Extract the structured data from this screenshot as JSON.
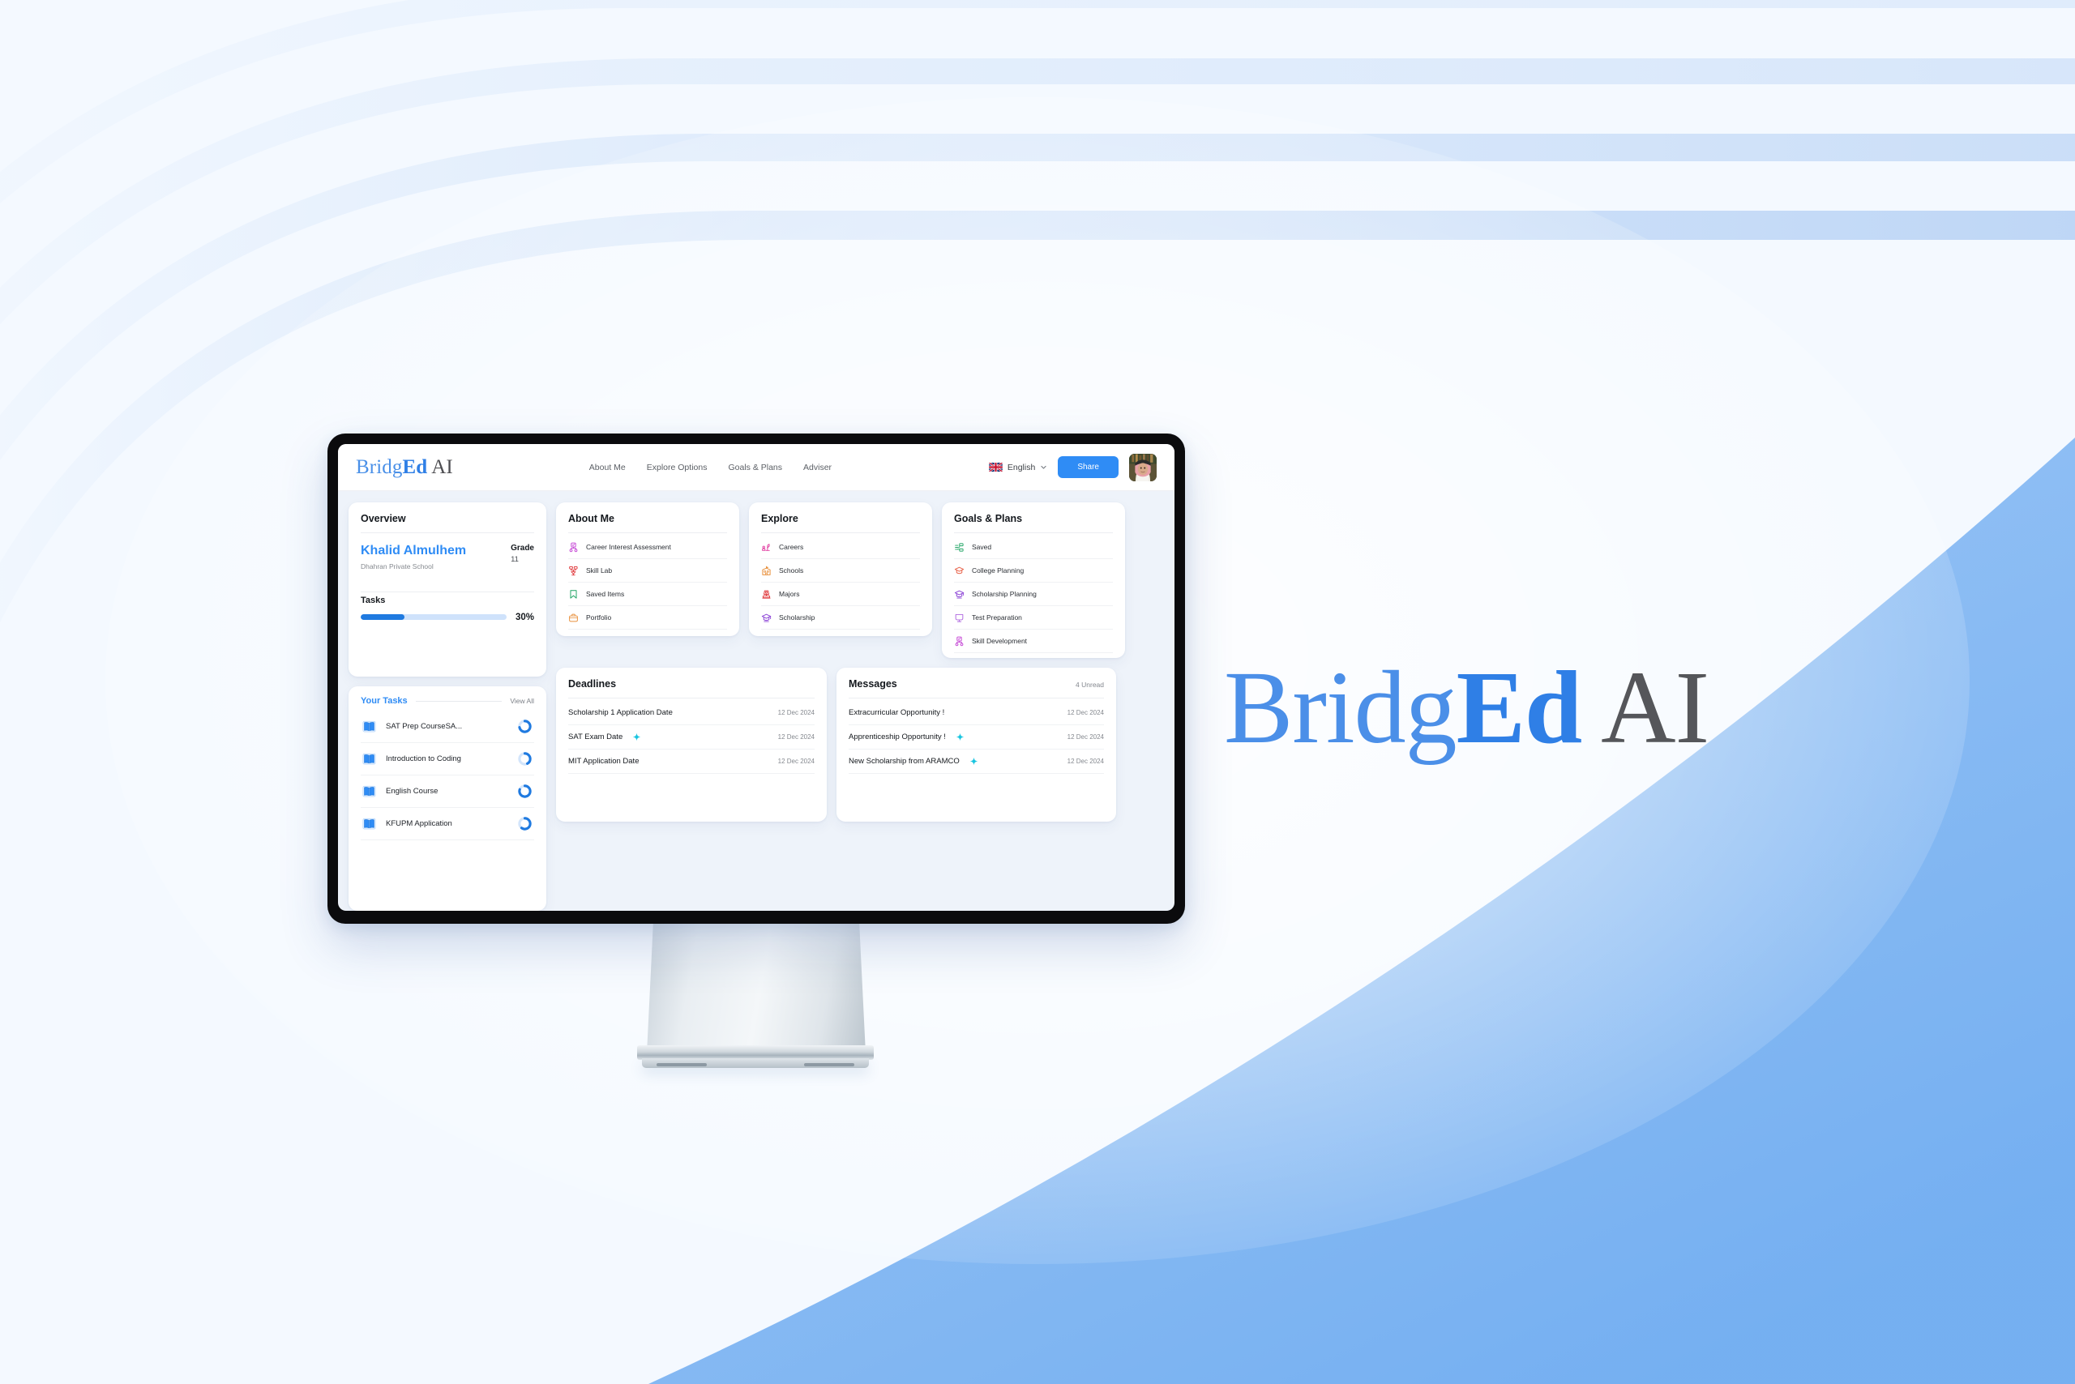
{
  "brand": {
    "part1": "Bridg",
    "part2": "Ed",
    "part3": " AI"
  },
  "header": {
    "nav": [
      {
        "label": "About Me"
      },
      {
        "label": "Explore Options"
      },
      {
        "label": "Goals & Plans"
      },
      {
        "label": "Adviser"
      }
    ],
    "language": "English",
    "share_label": "Share",
    "flag_icon": "uk-flag-icon",
    "chevron_icon": "chevron-down-icon",
    "avatar_icon": "user-avatar"
  },
  "overview": {
    "title": "Overview",
    "student_name": "Khalid Almulhem",
    "school": "Dhahran Private School",
    "grade_label": "Grade",
    "grade_value": "11",
    "tasks_label": "Tasks",
    "progress_percent": "30%",
    "progress_value": 30
  },
  "tasks": {
    "section_label": "Your Tasks",
    "view_all_label": "View All",
    "items": [
      {
        "label": "SAT Prep CourseSA...",
        "icon": "book-icon",
        "progress": 72
      },
      {
        "label": "Introduction to Coding",
        "icon": "book-icon",
        "progress": 42
      },
      {
        "label": "English Course",
        "icon": "book-icon",
        "progress": 80
      },
      {
        "label": "KFUPM Application",
        "icon": "book-icon",
        "progress": 60
      }
    ]
  },
  "about_me": {
    "title": "About Me",
    "items": [
      {
        "label": "Career Interest Assessment",
        "icon": "assessment-icon",
        "color": "#c64bd6"
      },
      {
        "label": "Skill Lab",
        "icon": "skill-lab-icon",
        "color": "#e0393c"
      },
      {
        "label": "Saved Items",
        "icon": "bookmark-icon",
        "color": "#1fa463"
      },
      {
        "label": "Portfolio",
        "icon": "briefcase-icon",
        "color": "#e8903c"
      }
    ]
  },
  "explore": {
    "title": "Explore",
    "items": [
      {
        "label": "Careers",
        "icon": "careers-icon",
        "color": "#e0399f"
      },
      {
        "label": "Schools",
        "icon": "school-building-icon",
        "color": "#e8903c"
      },
      {
        "label": "Majors",
        "icon": "majors-icon",
        "color": "#e0393c"
      },
      {
        "label": "Scholarship",
        "icon": "graduation-cap-icon",
        "color": "#8c44d6"
      }
    ]
  },
  "goals_plans": {
    "title": "Goals & Plans",
    "items": [
      {
        "label": "Saved",
        "icon": "saved-nodes-icon",
        "color": "#1fa463"
      },
      {
        "label": "College Planning",
        "icon": "college-cap-icon",
        "color": "#e8634a"
      },
      {
        "label": "Scholarship Planning",
        "icon": "graduation-cap-icon",
        "color": "#8c44d6"
      },
      {
        "label": "Test Preparation",
        "icon": "monitor-icon",
        "color": "#b06ae0"
      },
      {
        "label": "Skill Development",
        "icon": "assessment-icon",
        "color": "#c64bd6"
      }
    ]
  },
  "deadlines": {
    "title": "Deadlines",
    "items": [
      {
        "label": "Scholarship 1 Application Date",
        "date": "12 Dec 2024",
        "sparkle": false
      },
      {
        "label": "SAT Exam Date",
        "date": "12 Dec 2024",
        "sparkle": true
      },
      {
        "label": "MIT Application Date",
        "date": "12 Dec 2024",
        "sparkle": false
      }
    ]
  },
  "messages": {
    "title": "Messages",
    "unread_label": "4 Unread",
    "items": [
      {
        "label": "Extracurricular Opportunity !",
        "date": "12 Dec 2024",
        "sparkle": false
      },
      {
        "label": "Apprenticeship Opportunity !",
        "date": "12 Dec 2024",
        "sparkle": true
      },
      {
        "label": "New Scholarship from ARAMCO",
        "date": "12 Dec 2024",
        "sparkle": true
      }
    ]
  },
  "colors": {
    "accent": "#2f8cf5",
    "brand_blue": "#2f7fe6",
    "sparkle": "#19c5e0",
    "page_bg": "#eef3fa"
  }
}
